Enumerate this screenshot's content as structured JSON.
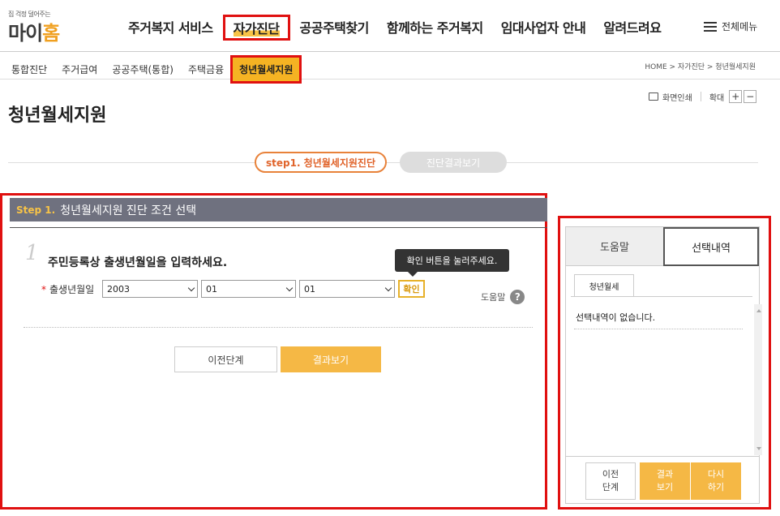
{
  "logo": {
    "tagline": "집 걱정 덜어주는",
    "name_1": "마이",
    "name_2": "홈"
  },
  "gnb": [
    {
      "label": "주거복지 서비스"
    },
    {
      "label": "자가진단"
    },
    {
      "label": "공공주택찾기"
    },
    {
      "label": "함께하는 주거복지"
    },
    {
      "label": "임대사업자 안내"
    },
    {
      "label": "알려드려요"
    }
  ],
  "allmenu_label": "전체메뉴",
  "subnav": [
    {
      "label": "통합진단"
    },
    {
      "label": "주거급여"
    },
    {
      "label": "공공주택(통합)"
    },
    {
      "label": "주택금융"
    },
    {
      "label": "청년월세지원"
    }
  ],
  "breadcrumb": "HOME > 자가진단 > 청년월세지원",
  "tools": {
    "print": "화면인쇄",
    "zoom": "확대",
    "zoom_in": "+",
    "zoom_out": "−"
  },
  "page_title": "청년월세지원",
  "steps": {
    "step1": "step1. 청년월세지원진단",
    "step2": "진단결과보기"
  },
  "step_header": {
    "no": "Step 1.",
    "text": "청년월세지원 진단 조건 선택"
  },
  "question": {
    "number": "1",
    "text": "주민등록상 출생년월일을 입력하세요.",
    "label": "출생년월일",
    "required_mark": "*",
    "year": "2003",
    "month": "01",
    "day": "01",
    "confirm": "확인",
    "tooltip": "확인 버튼을 눌러주세요.",
    "help": "도움말",
    "help_icon": "?"
  },
  "buttons": {
    "prev": "이전단계",
    "result": "결과보기"
  },
  "right_panel": {
    "tab_help": "도움말",
    "tab_selection": "선택내역",
    "subtab": "청년월세",
    "empty_text": "선택내역이 없습니다.",
    "btn_prev": "이전\n단계",
    "btn_result": "결과\n보기",
    "btn_reset": "다시\n하기"
  }
}
